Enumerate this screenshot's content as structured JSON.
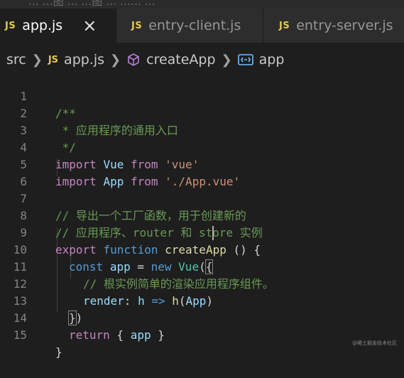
{
  "top_strip_text": "…   …图 …  …图 …  …… …",
  "tabs": [
    {
      "icon": "JS",
      "label": "app.js",
      "active": true,
      "close": "×"
    },
    {
      "icon": "JS",
      "label": "entry-client.js",
      "active": false
    },
    {
      "icon": "JS",
      "label": "entry-server.js",
      "active": false
    }
  ],
  "breadcrumb": {
    "folder": "src",
    "file_icon": "JS",
    "file": "app.js",
    "function": "createApp",
    "variable": "app"
  },
  "line_numbers": [
    "1",
    "2",
    "3",
    "4",
    "5",
    "6",
    "7",
    "8",
    "9",
    "10",
    "11",
    "12",
    "13",
    "14",
    "15"
  ],
  "code": {
    "l1": "/**",
    "l2": " * 应用程序的通用入口",
    "l3": " */",
    "l4_kw": "import",
    "l4_name": "Vue",
    "l4_from": "from",
    "l4_str": "'vue'",
    "l5_kw": "import",
    "l5_name": "App",
    "l5_from": "from",
    "l5_str": "'./App.vue'",
    "l7": "// 导出一个工厂函数，用于创建新的",
    "l8": "// 应用程序、router 和 store 实例",
    "l9_export": "export",
    "l9_function": "function",
    "l9_name": "createApp",
    "l9_rest": " () {",
    "l10_const": "const",
    "l10_var": "app",
    "l10_eq": " = ",
    "l10_new": "new",
    "l10_type": "Vue",
    "l10_paren": "(",
    "l10_brace": "{",
    "l11": "// 根实例简单的渲染应用程序组件。",
    "l12_prop": "render",
    "l12_colon": ": ",
    "l12_h": "h",
    "l12_arrow": " => ",
    "l12_call": "h",
    "l12_open": "(",
    "l12_arg": "App",
    "l12_close": ")",
    "l13_brace": "}",
    "l13_paren": ")",
    "l14_kw": "return",
    "l14_open": " { ",
    "l14_var": "app",
    "l14_close": " }",
    "l15": "}"
  },
  "watermark": "@稀土掘金技术社区"
}
